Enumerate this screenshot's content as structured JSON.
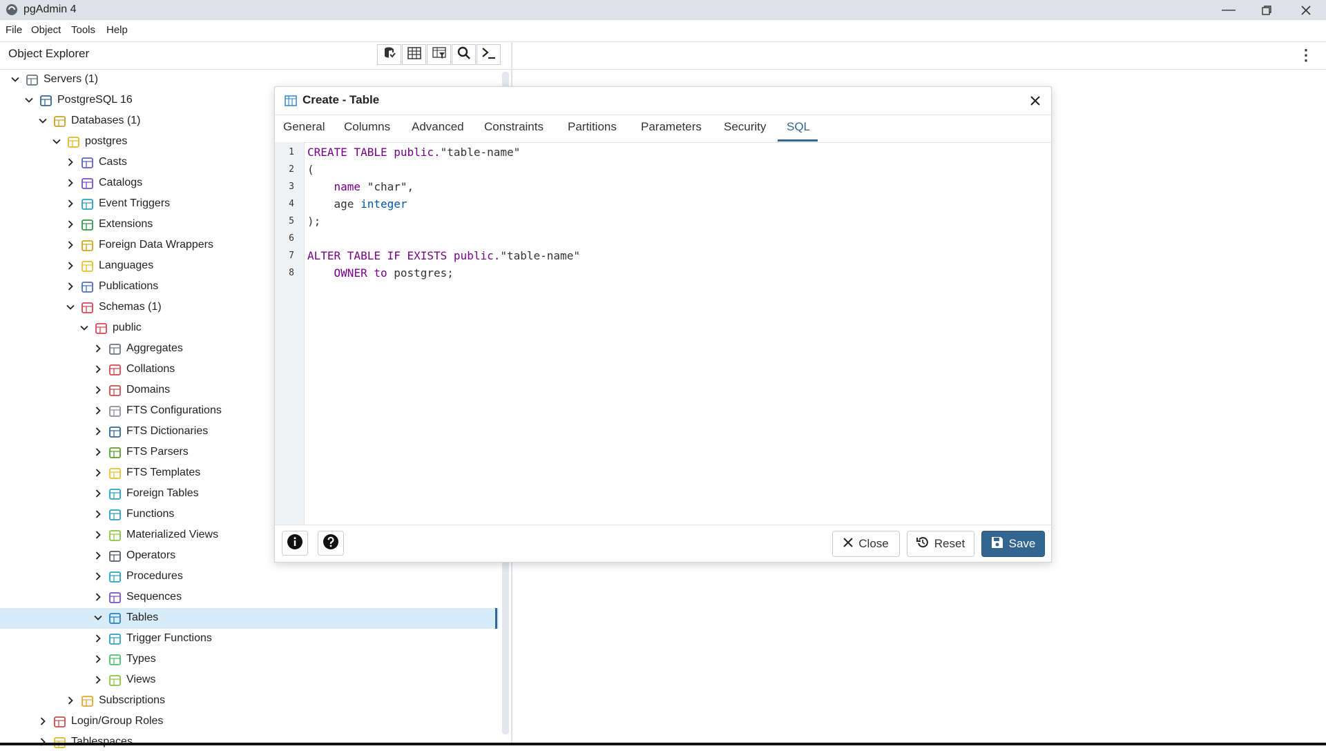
{
  "app": {
    "title": "pgAdmin 4"
  },
  "menu": [
    "File",
    "Object",
    "Tools",
    "Help"
  ],
  "explorer": {
    "title": "Object Explorer",
    "toolbar": [
      "database-query-icon",
      "table-view-icon",
      "filtered-rows-icon",
      "search-icon",
      "psql-terminal-icon"
    ]
  },
  "tree": [
    {
      "label": "Servers (1)",
      "level": 0,
      "expanded": true,
      "icon": "servers-icon",
      "color": "#6b7480"
    },
    {
      "label": "PostgreSQL 16",
      "level": 1,
      "expanded": true,
      "icon": "postgresql-elephant-icon",
      "color": "#336791"
    },
    {
      "label": "Databases (1)",
      "level": 2,
      "expanded": true,
      "icon": "databases-icon",
      "color": "#c9a227"
    },
    {
      "label": "postgres",
      "level": 3,
      "expanded": true,
      "icon": "database-icon",
      "color": "#e0b829"
    },
    {
      "label": "Casts",
      "level": 4,
      "expanded": false,
      "icon": "casts-icon",
      "color": "#5b5fc7"
    },
    {
      "label": "Catalogs",
      "level": 4,
      "expanded": false,
      "icon": "catalogs-icon",
      "color": "#7a4fc2"
    },
    {
      "label": "Event Triggers",
      "level": 4,
      "expanded": false,
      "icon": "event-triggers-icon",
      "color": "#2aa1c0"
    },
    {
      "label": "Extensions",
      "level": 4,
      "expanded": false,
      "icon": "extensions-icon",
      "color": "#2e9a4b"
    },
    {
      "label": "Foreign Data Wrappers",
      "level": 4,
      "expanded": false,
      "icon": "foreign-data-wrappers-icon",
      "color": "#d4a61c"
    },
    {
      "label": "Languages",
      "level": 4,
      "expanded": false,
      "icon": "languages-icon",
      "color": "#e6c12d"
    },
    {
      "label": "Publications",
      "level": 4,
      "expanded": false,
      "icon": "publications-icon",
      "color": "#4a6fc2"
    },
    {
      "label": "Schemas (1)",
      "level": 4,
      "expanded": true,
      "icon": "schemas-icon",
      "color": "#d94452"
    },
    {
      "label": "public",
      "level": 5,
      "expanded": true,
      "icon": "schema-icon",
      "color": "#d94452"
    },
    {
      "label": "Aggregates",
      "level": 6,
      "expanded": false,
      "icon": "aggregates-icon",
      "color": "#6b7480"
    },
    {
      "label": "Collations",
      "level": 6,
      "expanded": false,
      "icon": "collations-icon",
      "color": "#d94452"
    },
    {
      "label": "Domains",
      "level": 6,
      "expanded": false,
      "icon": "domains-icon",
      "color": "#c0504d"
    },
    {
      "label": "FTS Configurations",
      "level": 6,
      "expanded": false,
      "icon": "fts-configurations-icon",
      "color": "#8a8f96"
    },
    {
      "label": "FTS Dictionaries",
      "level": 6,
      "expanded": false,
      "icon": "fts-dictionaries-icon",
      "color": "#336791"
    },
    {
      "label": "FTS Parsers",
      "level": 6,
      "expanded": false,
      "icon": "fts-parsers-icon",
      "color": "#5a9e2b"
    },
    {
      "label": "FTS Templates",
      "level": 6,
      "expanded": false,
      "icon": "fts-templates-icon",
      "color": "#e6c12d"
    },
    {
      "label": "Foreign Tables",
      "level": 6,
      "expanded": false,
      "icon": "foreign-tables-icon",
      "color": "#2aa1c0"
    },
    {
      "label": "Functions",
      "level": 6,
      "expanded": false,
      "icon": "functions-icon",
      "color": "#2aa1c0"
    },
    {
      "label": "Materialized Views",
      "level": 6,
      "expanded": false,
      "icon": "materialized-views-icon",
      "color": "#8cc63f"
    },
    {
      "label": "Operators",
      "level": 6,
      "expanded": false,
      "icon": "operators-icon",
      "color": "#555c66"
    },
    {
      "label": "Procedures",
      "level": 6,
      "expanded": false,
      "icon": "procedures-icon",
      "color": "#2aa1c0"
    },
    {
      "label": "Sequences",
      "level": 6,
      "expanded": false,
      "icon": "sequences-icon",
      "color": "#7a4fc2"
    },
    {
      "label": "Tables",
      "level": 6,
      "expanded": true,
      "selected": true,
      "icon": "tables-icon",
      "color": "#2a7fc0"
    },
    {
      "label": "Trigger Functions",
      "level": 6,
      "expanded": false,
      "icon": "trigger-functions-icon",
      "color": "#2aa1c0"
    },
    {
      "label": "Types",
      "level": 6,
      "expanded": false,
      "icon": "types-icon",
      "color": "#4cbf6a"
    },
    {
      "label": "Views",
      "level": 6,
      "expanded": false,
      "icon": "views-icon",
      "color": "#8cc63f"
    },
    {
      "label": "Subscriptions",
      "level": 4,
      "expanded": false,
      "icon": "subscriptions-icon",
      "color": "#e6a52d"
    },
    {
      "label": "Login/Group Roles",
      "level": 2,
      "expanded": false,
      "icon": "login-group-roles-icon",
      "color": "#c0504d"
    },
    {
      "label": "Tablespaces",
      "level": 2,
      "expanded": false,
      "icon": "tablespaces-icon",
      "color": "#e0b829"
    }
  ],
  "dialog": {
    "title": "Create - Table",
    "tabs": [
      "General",
      "Columns",
      "Advanced",
      "Constraints",
      "Partitions",
      "Parameters",
      "Security",
      "SQL"
    ],
    "active_tab": "SQL",
    "sql_lines": [
      [
        {
          "t": "CREATE TABLE public.",
          "c": "kw"
        },
        {
          "t": "\"table-name\"",
          "c": "plain"
        }
      ],
      [
        {
          "t": "(",
          "c": "plain"
        }
      ],
      [
        {
          "t": "    ",
          "c": "plain"
        },
        {
          "t": "name",
          "c": "kw"
        },
        {
          "t": " \"char\",",
          "c": "plain"
        }
      ],
      [
        {
          "t": "    age ",
          "c": "plain"
        },
        {
          "t": "integer",
          "c": "ty"
        }
      ],
      [
        {
          "t": ");",
          "c": "plain"
        }
      ],
      [],
      [
        {
          "t": "ALTER TABLE IF EXISTS public.",
          "c": "kw"
        },
        {
          "t": "\"table-name\"",
          "c": "plain"
        }
      ],
      [
        {
          "t": "    ",
          "c": "plain"
        },
        {
          "t": "OWNER to",
          "c": "kw"
        },
        {
          "t": " postgres;",
          "c": "plain"
        }
      ]
    ],
    "buttons": {
      "close": "Close",
      "reset": "Reset",
      "save": "Save"
    }
  },
  "colors": {
    "accent": "#326690",
    "selection": "#d6ecf8",
    "keyword": "#770088",
    "type": "#0055aa"
  }
}
